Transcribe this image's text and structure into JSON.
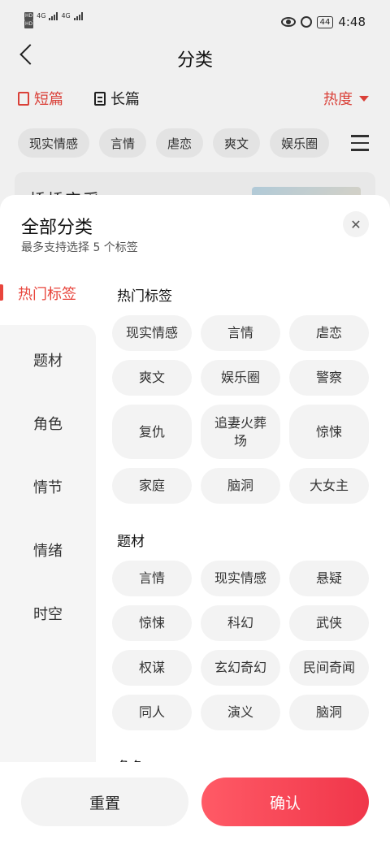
{
  "status": {
    "left_top": "HD 4G",
    "left_bottom": "HD",
    "battery": "44",
    "time": "4:48"
  },
  "header": {
    "title": "分类"
  },
  "types": {
    "short": "短篇",
    "long": "长篇",
    "sort": "热度"
  },
  "quick_tags": [
    "现实情感",
    "言情",
    "虐恋",
    "爽文",
    "娱乐圈"
  ],
  "background": {
    "card_text": "桥桥宝采"
  },
  "sheet": {
    "title": "全部分类",
    "subtitle": "最多支持选择 5 个标签",
    "close": "✕"
  },
  "sidebar": {
    "active": "热门标签",
    "items": [
      "题材",
      "角色",
      "情节",
      "情绪",
      "时空"
    ]
  },
  "sections": [
    {
      "title": "热门标签",
      "tags": [
        "现实情感",
        "言情",
        "虐恋",
        "爽文",
        "娱乐圈",
        "警察",
        "复仇",
        "追妻火葬场",
        "惊悚",
        "家庭",
        "脑洞",
        "大女主"
      ]
    },
    {
      "title": "题材",
      "tags": [
        "言情",
        "现实情感",
        "悬疑",
        "惊悚",
        "科幻",
        "武侠",
        "权谋",
        "玄幻奇幻",
        "民间奇闻",
        "同人",
        "演义",
        "脑洞"
      ]
    },
    {
      "title": "角色",
      "tags": []
    }
  ],
  "footer": {
    "reset": "重置",
    "confirm": "确认"
  },
  "colors": {
    "accent": "#e8453c",
    "chip_bg": "#f3f3f3"
  }
}
